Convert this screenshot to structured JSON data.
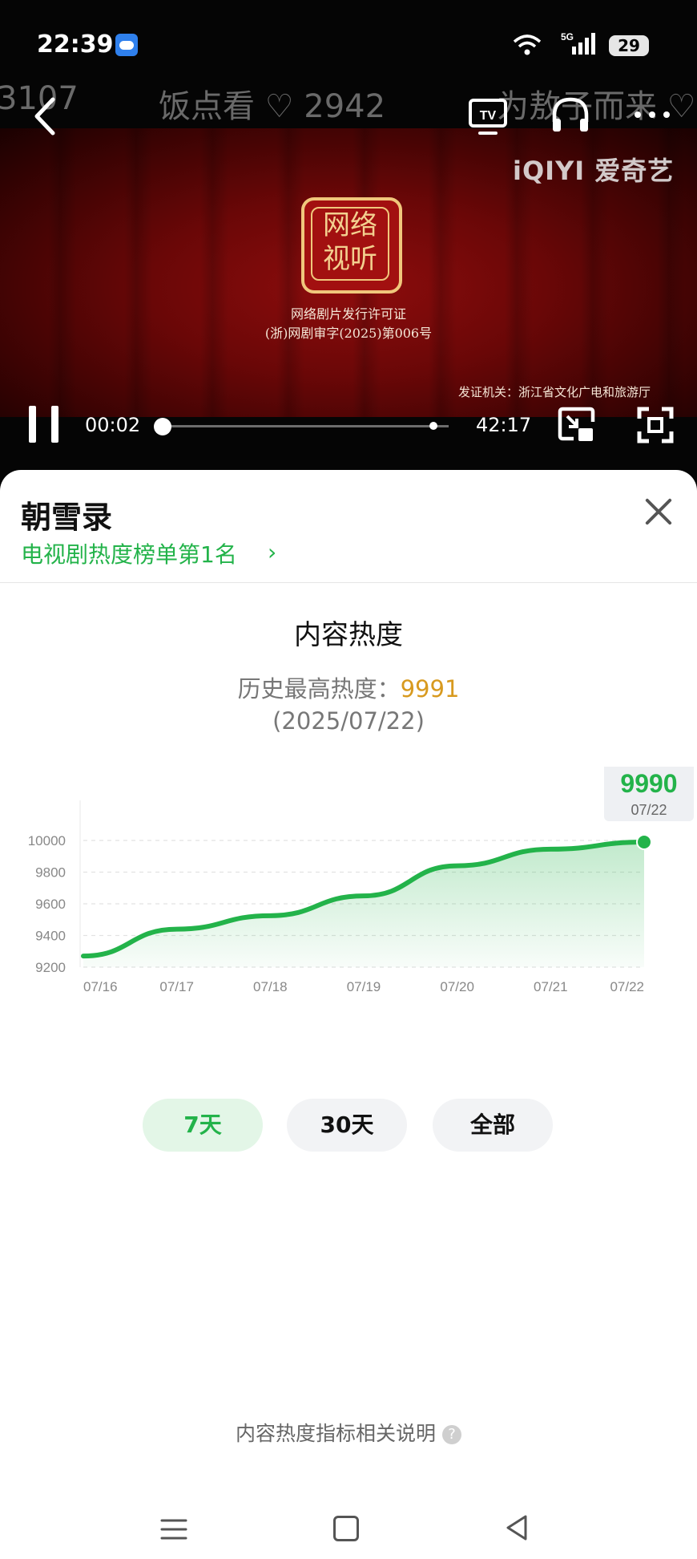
{
  "status_bar": {
    "time": "22:39",
    "network": "5G",
    "battery": "29"
  },
  "top_ticker": {
    "left_fragment": "3107",
    "middle": "饭点看 ♡ 2942",
    "right_fragment": "为敖子而来 ♡"
  },
  "video": {
    "brand": "iQIYI 爱奇艺",
    "seal_text": "网络\n视听",
    "license_line1": "网络剧片发行许可证",
    "license_line2": "(浙)网剧审字(2025)第006号",
    "issuer": "发证机关：浙江省文化广电和旅游厅",
    "current_time": "00:02",
    "total_time": "42:17",
    "progress_fraction": 0.0008
  },
  "sheet": {
    "title": "朝雪录",
    "rank_link": "电视剧热度榜单第1名",
    "rank_chevron": "›",
    "section_title": "内容热度",
    "peak_label": "历史最高热度：",
    "peak_value": "9991",
    "peak_date": "(2025/07/22)",
    "range_buttons": [
      "7天",
      "30天",
      "全部"
    ],
    "selected_range": "7天",
    "metric_note": "内容热度指标相关说明",
    "help_icon": "?"
  },
  "colors": {
    "accent_green": "#23b34a",
    "peak_orange": "#d89a1f",
    "video_red": "#8e0d0d"
  },
  "chart_data": {
    "type": "area",
    "x": [
      "07/16",
      "07/17",
      "07/18",
      "07/19",
      "07/20",
      "07/21",
      "07/22"
    ],
    "y_ticks": [
      9200,
      9400,
      9600,
      9800,
      10000
    ],
    "ylim": [
      9200,
      10000
    ],
    "series": [
      {
        "values": [
          9270,
          9440,
          9525,
          9650,
          9840,
          9945,
          9990
        ]
      }
    ],
    "tooltip": {
      "value": "9990",
      "date": "07/22"
    },
    "grid": true
  }
}
